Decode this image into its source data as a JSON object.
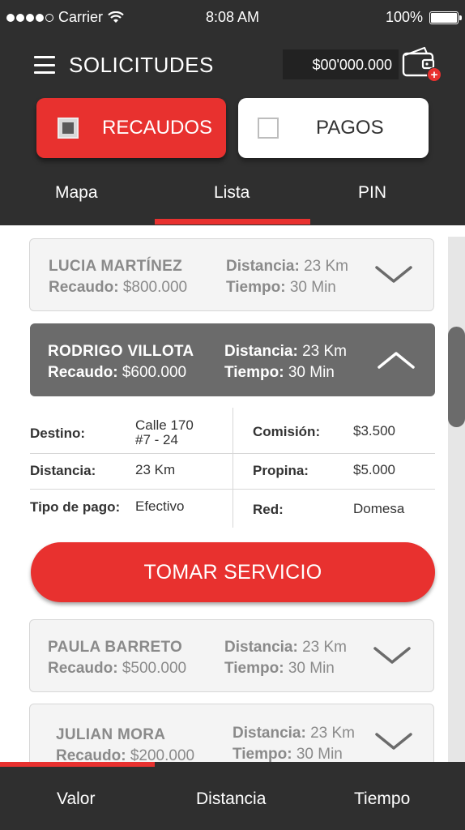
{
  "status_bar": {
    "carrier": "Carrier",
    "time": "8:08 AM",
    "battery": "100%",
    "signal_bars": 5,
    "signal_bars_filled": 4
  },
  "nav": {
    "title": "SOLICITUDES",
    "balance": "$00'000.000",
    "wallet_badge": "+"
  },
  "toggles": {
    "recaudos": {
      "label": "RECAUDOS",
      "checked": true
    },
    "pagos": {
      "label": "PAGOS",
      "checked": false
    }
  },
  "tabs": [
    {
      "label": "Mapa",
      "active": false
    },
    {
      "label": "Lista",
      "active": true
    },
    {
      "label": "PIN",
      "active": false
    }
  ],
  "list": {
    "distance_label": "Distancia:",
    "time_label": "Tiempo:",
    "amount_label": "Recaudo:",
    "items": [
      {
        "name": "LUCIA MARTÍNEZ",
        "amount": "$800.000",
        "distance": "23 Km",
        "time": "30 Min",
        "expanded": false
      },
      {
        "name": "RODRIGO VILLOTA",
        "amount": "$600.000",
        "distance": "23 Km",
        "time": "30 Min",
        "expanded": true
      },
      {
        "name": "PAULA BARRETO",
        "amount": "$500.000",
        "distance": "23 Km",
        "time": "30 Min",
        "expanded": false
      },
      {
        "name": "JULIAN MORA",
        "amount": "$200.000",
        "distance": "23 Km",
        "time": "30 Min",
        "expanded": false
      }
    ]
  },
  "details": {
    "destino_label": "Destino:",
    "destino_line1": "Calle 170",
    "destino_line2": "#7 - 24",
    "distancia_label": "Distancia:",
    "distancia_value": "23 Km",
    "tipo_pago_label": "Tipo de pago:",
    "tipo_pago_value": "Efectivo",
    "comision_label": "Comisión:",
    "comision_value": "$3.500",
    "propina_label": "Propina:",
    "propina_value": "$5.000",
    "red_label": "Red:",
    "red_value": "Domesa"
  },
  "cta": {
    "label": "TOMAR SERVICIO"
  },
  "bottom_bar": {
    "items": [
      "Valor",
      "Distancia",
      "Tiempo"
    ],
    "active_index": 0
  },
  "colors": {
    "accent": "#e8312f",
    "header_bg": "#2f2f2f",
    "card_active_bg": "#6b6b6b",
    "card_bg": "#f4f4f4"
  },
  "icons": [
    "wifi-icon",
    "battery-icon",
    "menu-icon",
    "wallet-icon",
    "chevron-down-icon",
    "chevron-up-icon",
    "checkbox-icon"
  ]
}
